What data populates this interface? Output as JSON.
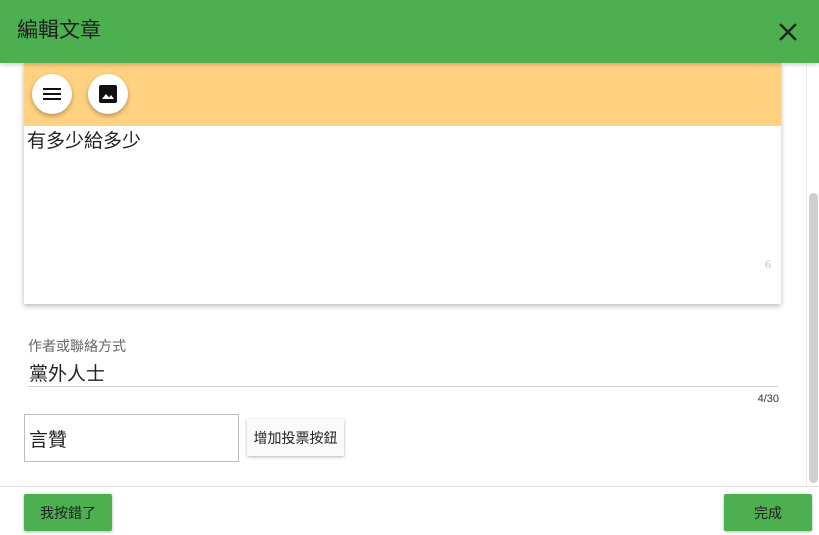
{
  "header": {
    "title": "編輯文章",
    "close_icon": "close-icon",
    "background_color": "#4caf50"
  },
  "editor": {
    "toolbar_color": "#ffd180",
    "toolbar_icons": [
      "menu-icon",
      "image-icon"
    ],
    "text": "有多少給多少",
    "char_count": "6"
  },
  "author_field": {
    "label": "作者或聯絡方式",
    "value": "黨外人士",
    "counter": "4/30"
  },
  "vote": {
    "input_value": "言贊",
    "add_button_label": "增加投票按鈕"
  },
  "footer": {
    "cancel_label": "我按錯了",
    "done_label": "完成"
  }
}
